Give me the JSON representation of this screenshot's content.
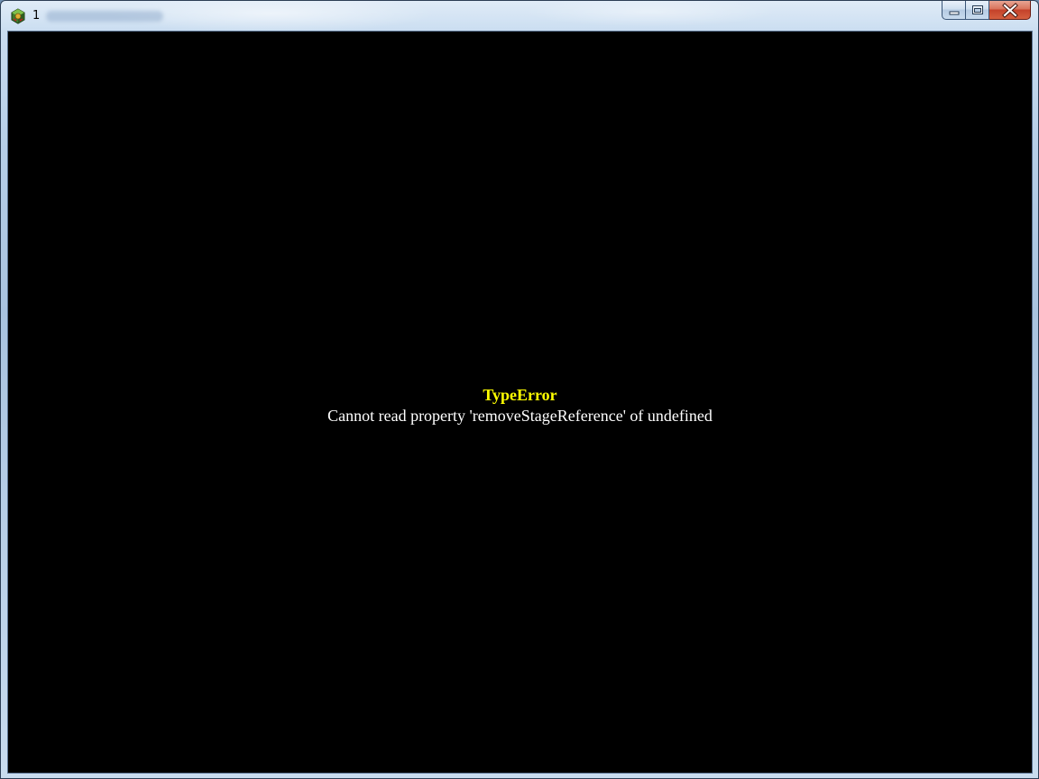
{
  "window": {
    "title": "1",
    "icon": "rpg-maker-app-icon"
  },
  "caption_buttons": {
    "minimize": "minimize-icon",
    "maximize": "maximize-icon",
    "close": "close-icon"
  },
  "error": {
    "title": "TypeError",
    "message": "Cannot read property 'removeStageReference' of undefined"
  },
  "colors": {
    "error_title": "#ffff00",
    "error_message": "#ffffff",
    "background": "#000000",
    "close_button": "#c4412a"
  }
}
